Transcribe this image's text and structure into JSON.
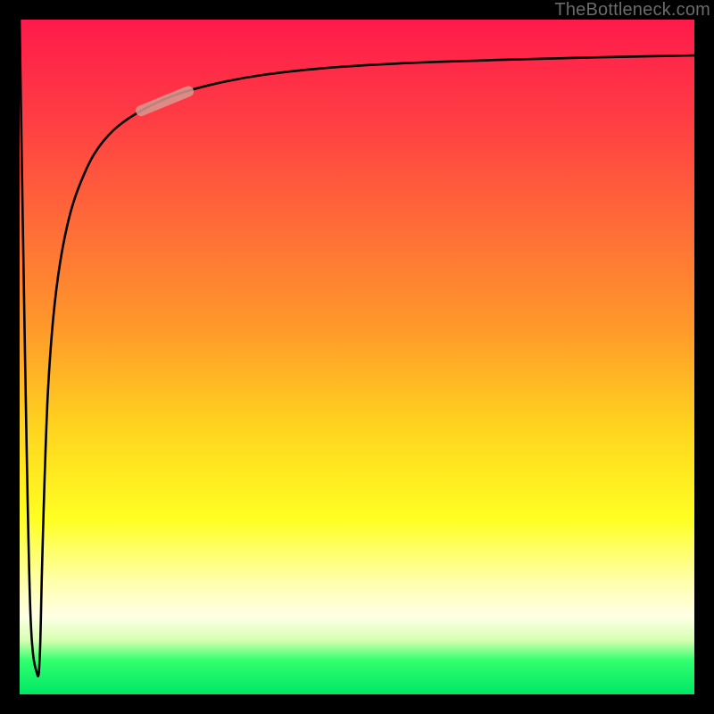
{
  "watermark": "TheBottleneck.com",
  "chart_data": {
    "type": "line",
    "title": "",
    "xlabel": "",
    "ylabel": "",
    "xlim": [
      0,
      100
    ],
    "ylim": [
      0,
      100
    ],
    "grid": false,
    "series": [
      {
        "name": "bottleneck-curve",
        "x": [
          0.0,
          0.8,
          1.6,
          2.6,
          3.0,
          3.3,
          3.7,
          4.2,
          5.0,
          6.0,
          7.3,
          8.7,
          11.0,
          14.0,
          18.0,
          23.0,
          29.0,
          36.0,
          45.0,
          56.0,
          70.0,
          85.0,
          100.0
        ],
        "values": [
          100.0,
          50.0,
          12.0,
          3.0,
          6.0,
          18.0,
          32.0,
          45.0,
          56.0,
          64.0,
          70.5,
          75.0,
          80.0,
          83.7,
          86.5,
          88.8,
          90.5,
          91.8,
          92.8,
          93.5,
          94.0,
          94.4,
          94.7
        ]
      }
    ],
    "highlight_segment": {
      "series": "bottleneck-curve",
      "x_start": 18.0,
      "x_end": 25.0
    }
  }
}
